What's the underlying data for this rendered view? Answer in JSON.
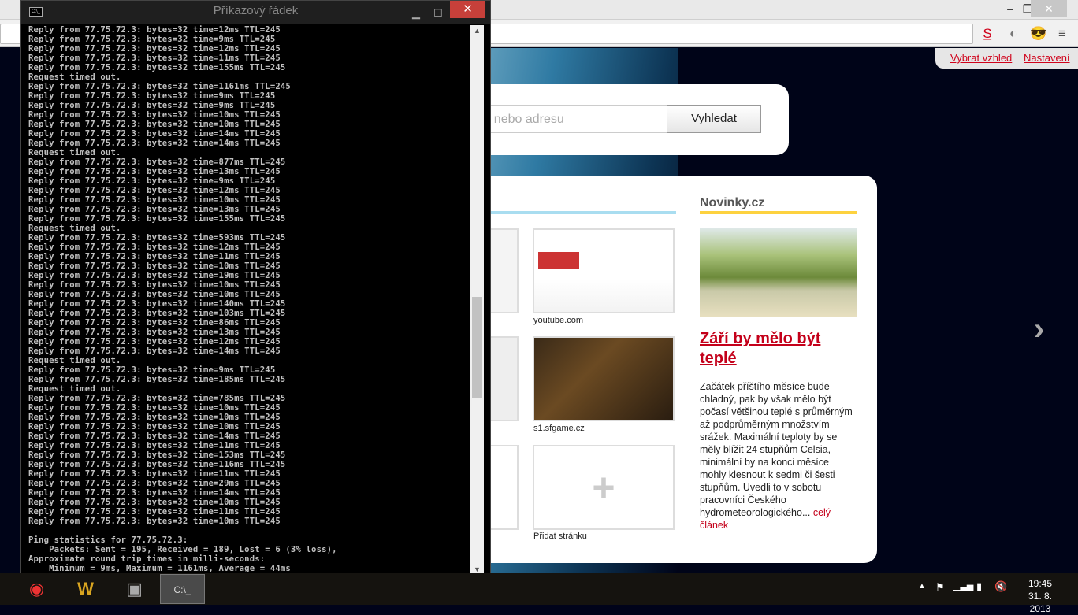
{
  "cmd": {
    "title": "Příkazový řádek",
    "icon_text": "C:\\_",
    "lines": [
      "Reply from 77.75.72.3: bytes=32 time=12ms TTL=245",
      "Reply from 77.75.72.3: bytes=32 time=9ms TTL=245",
      "Reply from 77.75.72.3: bytes=32 time=12ms TTL=245",
      "Reply from 77.75.72.3: bytes=32 time=11ms TTL=245",
      "Reply from 77.75.72.3: bytes=32 time=155ms TTL=245",
      "Request timed out.",
      "Reply from 77.75.72.3: bytes=32 time=1161ms TTL=245",
      "Reply from 77.75.72.3: bytes=32 time=9ms TTL=245",
      "Reply from 77.75.72.3: bytes=32 time=9ms TTL=245",
      "Reply from 77.75.72.3: bytes=32 time=10ms TTL=245",
      "Reply from 77.75.72.3: bytes=32 time=10ms TTL=245",
      "Reply from 77.75.72.3: bytes=32 time=14ms TTL=245",
      "Reply from 77.75.72.3: bytes=32 time=14ms TTL=245",
      "Request timed out.",
      "Reply from 77.75.72.3: bytes=32 time=877ms TTL=245",
      "Reply from 77.75.72.3: bytes=32 time=13ms TTL=245",
      "Reply from 77.75.72.3: bytes=32 time=9ms TTL=245",
      "Reply from 77.75.72.3: bytes=32 time=12ms TTL=245",
      "Reply from 77.75.72.3: bytes=32 time=10ms TTL=245",
      "Reply from 77.75.72.3: bytes=32 time=13ms TTL=245",
      "Reply from 77.75.72.3: bytes=32 time=155ms TTL=245",
      "Request timed out.",
      "Reply from 77.75.72.3: bytes=32 time=593ms TTL=245",
      "Reply from 77.75.72.3: bytes=32 time=12ms TTL=245",
      "Reply from 77.75.72.3: bytes=32 time=11ms TTL=245",
      "Reply from 77.75.72.3: bytes=32 time=10ms TTL=245",
      "Reply from 77.75.72.3: bytes=32 time=19ms TTL=245",
      "Reply from 77.75.72.3: bytes=32 time=10ms TTL=245",
      "Reply from 77.75.72.3: bytes=32 time=10ms TTL=245",
      "Reply from 77.75.72.3: bytes=32 time=140ms TTL=245",
      "Reply from 77.75.72.3: bytes=32 time=103ms TTL=245",
      "Reply from 77.75.72.3: bytes=32 time=86ms TTL=245",
      "Reply from 77.75.72.3: bytes=32 time=13ms TTL=245",
      "Reply from 77.75.72.3: bytes=32 time=12ms TTL=245",
      "Reply from 77.75.72.3: bytes=32 time=14ms TTL=245",
      "Request timed out.",
      "Reply from 77.75.72.3: bytes=32 time=9ms TTL=245",
      "Reply from 77.75.72.3: bytes=32 time=185ms TTL=245",
      "Request timed out.",
      "Reply from 77.75.72.3: bytes=32 time=785ms TTL=245",
      "Reply from 77.75.72.3: bytes=32 time=10ms TTL=245",
      "Reply from 77.75.72.3: bytes=32 time=10ms TTL=245",
      "Reply from 77.75.72.3: bytes=32 time=10ms TTL=245",
      "Reply from 77.75.72.3: bytes=32 time=14ms TTL=245",
      "Reply from 77.75.72.3: bytes=32 time=11ms TTL=245",
      "Reply from 77.75.72.3: bytes=32 time=153ms TTL=245",
      "Reply from 77.75.72.3: bytes=32 time=116ms TTL=245",
      "Reply from 77.75.72.3: bytes=32 time=11ms TTL=245",
      "Reply from 77.75.72.3: bytes=32 time=29ms TTL=245",
      "Reply from 77.75.72.3: bytes=32 time=14ms TTL=245",
      "Reply from 77.75.72.3: bytes=32 time=10ms TTL=245",
      "Reply from 77.75.72.3: bytes=32 time=11ms TTL=245",
      "Reply from 77.75.72.3: bytes=32 time=10ms TTL=245",
      "",
      "Ping statistics for 77.75.72.3:",
      "    Packets: Sent = 195, Received = 189, Lost = 6 (3% loss),",
      "Approximate round trip times in milli-seconds:",
      "    Minimum = 9ms, Maximum = 1161ms, Average = 44ms"
    ]
  },
  "browser": {
    "links": {
      "theme": "Vybrat vzhled",
      "settings": "Nastavení"
    },
    "search": {
      "placeholder": "taz nebo adresu",
      "button": "Vyhledat"
    },
    "tiles": [
      {
        "label": "youtube.com"
      },
      {
        "label": "s1.sfgame.cz"
      },
      {
        "label": "Přidat stránku"
      }
    ],
    "news": {
      "source": "Novinky.cz",
      "headline": "Září by mělo být teplé",
      "body": "Začátek příštího měsíce bude chladný, pak by však mělo být počasí většinou teplé s průměrným až podprůměrným množstvím srážek. Maximální teploty by se měly blížit 24 stupňům Celsia, minimální by na konci měsíce mohly klesnout k sedmi či šesti stupňům. Uvedli to v sobotu pracovníci Českého hydrometeorologického...",
      "more": " celý článek"
    }
  },
  "taskbar": {
    "time": "19:45",
    "date": "31. 8. 2013"
  }
}
